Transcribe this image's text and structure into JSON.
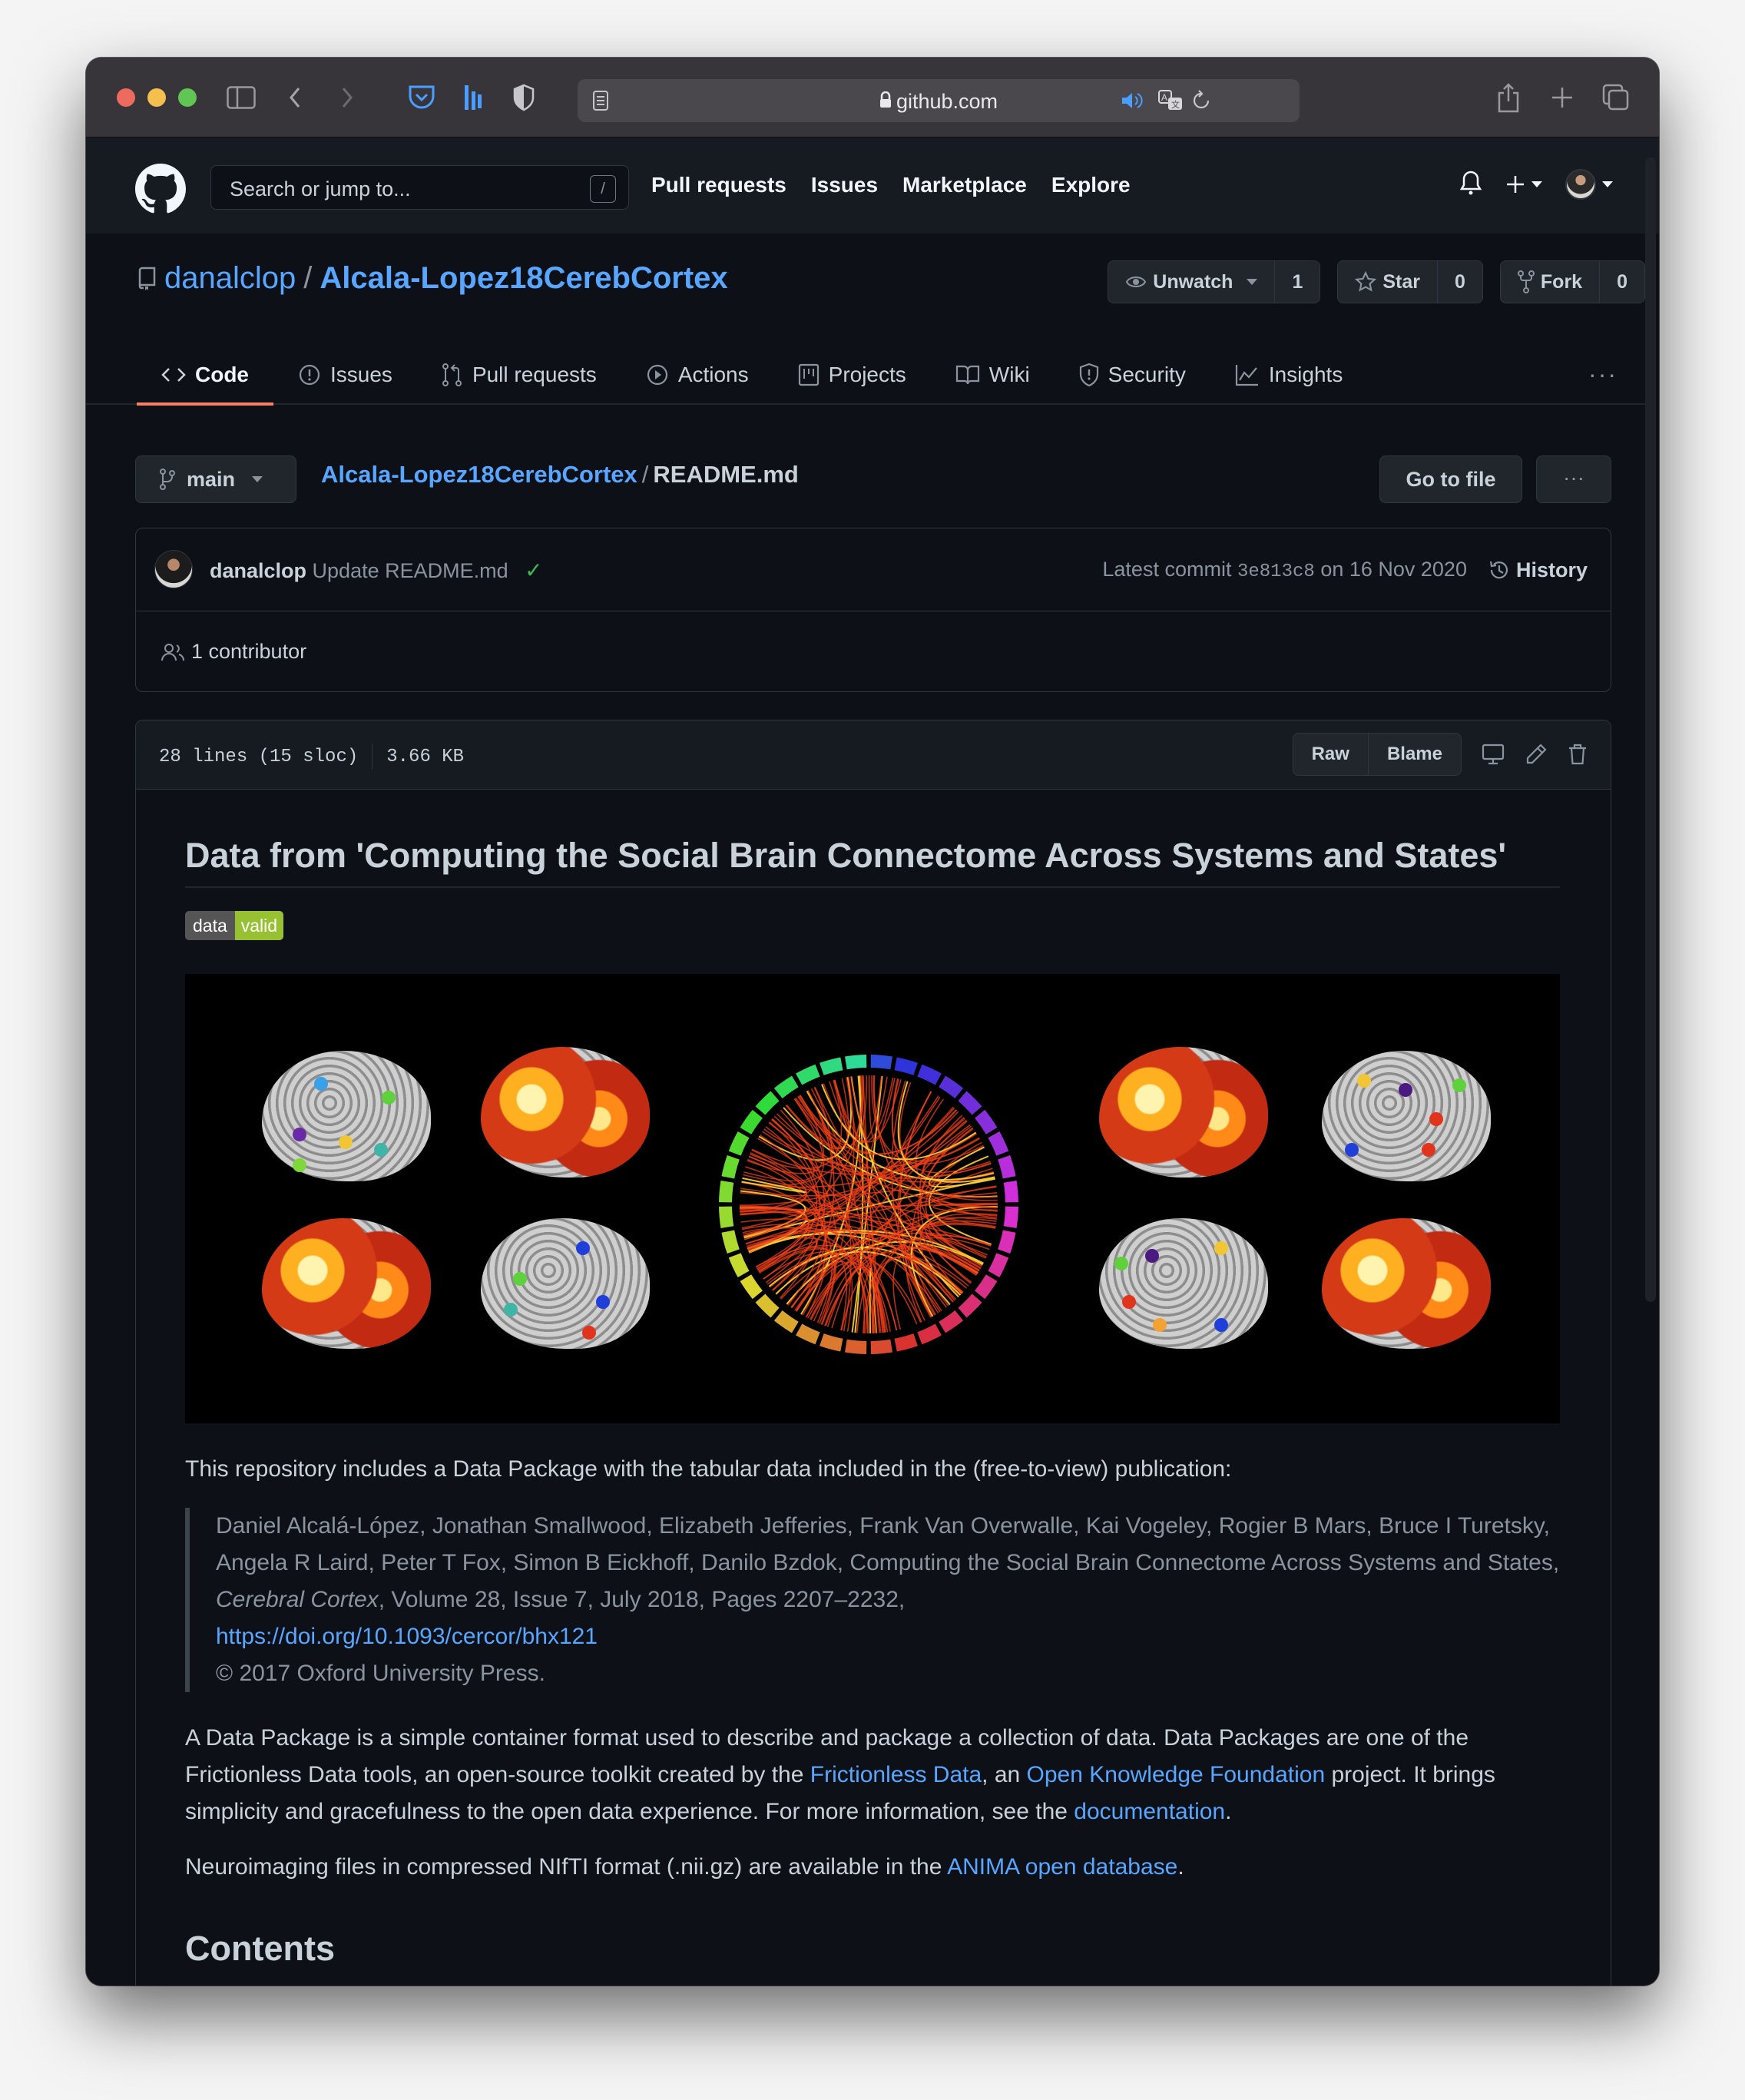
{
  "browser": {
    "url": "github.com",
    "icons": [
      "sidebar-icon",
      "back-icon",
      "forward-icon",
      "pocket-icon",
      "extension-icon",
      "privacy-shield-icon",
      "reader-icon",
      "audio-icon",
      "translate-icon",
      "reload-icon",
      "share-icon",
      "new-tab-icon",
      "tab-overview-icon"
    ]
  },
  "header": {
    "search_placeholder": "Search or jump to...",
    "search_shortcut": "/",
    "nav": [
      "Pull requests",
      "Issues",
      "Marketplace",
      "Explore"
    ]
  },
  "repo": {
    "owner": "danalclop",
    "separator": "/",
    "name": "Alcala-Lopez18CerebCortex",
    "watch_label": "Unwatch",
    "watch_count": "1",
    "star_label": "Star",
    "star_count": "0",
    "fork_label": "Fork",
    "fork_count": "0",
    "tabs": [
      {
        "label": "Code",
        "icon": "code-icon",
        "active": true
      },
      {
        "label": "Issues",
        "icon": "issue-icon",
        "active": false
      },
      {
        "label": "Pull requests",
        "icon": "pull-request-icon",
        "active": false
      },
      {
        "label": "Actions",
        "icon": "play-icon",
        "active": false
      },
      {
        "label": "Projects",
        "icon": "project-icon",
        "active": false
      },
      {
        "label": "Wiki",
        "icon": "book-icon",
        "active": false
      },
      {
        "label": "Security",
        "icon": "shield-icon",
        "active": false
      },
      {
        "label": "Insights",
        "icon": "graph-icon",
        "active": false
      }
    ],
    "more": "···"
  },
  "file_nav": {
    "branch": "main",
    "crumb_repo": "Alcala-Lopez18CerebCortex",
    "crumb_sep": "/",
    "crumb_file": "README.md",
    "go_to_file": "Go to file",
    "more": "···"
  },
  "commit": {
    "author": "danalclop",
    "message": "Update README.md",
    "status": "✓",
    "latest_prefix": "Latest commit",
    "sha": "3e813c8",
    "date_text": "on 16 Nov 2020",
    "history_label": "History",
    "contributors": "1 contributor"
  },
  "file": {
    "lines": "28 lines (15 sloc)",
    "size": "3.66 KB",
    "raw_label": "Raw",
    "blame_label": "Blame"
  },
  "readme": {
    "title": "Data from 'Computing the Social Brain Connectome Across Systems and States'",
    "badge_left": "data",
    "badge_right": "valid",
    "badge_colors": {
      "left": "#555555",
      "right": "#97c133"
    },
    "intro": "This repository includes a Data Package with the tabular data included in the (free-to-view) publication:",
    "citation": {
      "authors": "Daniel Alcalá-López, Jonathan Smallwood, Elizabeth Jefferies, Frank Van Overwalle, Kai Vogeley, Rogier B Mars, Bruce I Turetsky, Angela R Laird, Peter T Fox, Simon B Eickhoff, Danilo Bzdok, Computing the Social Brain Connectome Across Systems and States, ",
      "journal": "Cerebral Cortex",
      "details": ", Volume 28, Issue 7, July 2018, Pages 2207–2232,",
      "doi": "https://doi.org/10.1093/cercor/bhx121",
      "copyright": "© 2017 Oxford University Press."
    },
    "para2": {
      "t1": "A Data Package is a simple container format used to describe and package a collection of data. Data Packages are one of the Frictionless Data tools, an open-source toolkit created by the ",
      "link1": "Frictionless Data",
      "t2": ", an ",
      "link2": "Open Knowledge Foundation",
      "t3": " project. It brings simplicity and gracefulness to the open data experience. For more information, see the ",
      "link3": "documentation",
      "t4": "."
    },
    "para3": {
      "t1": "Neuroimaging files in compressed NIfTI format (.nii.gz) are available in the ",
      "link": "ANIMA open database",
      "t2": "."
    },
    "contents_heading": "Contents"
  },
  "colors": {
    "link": "#58a6ff",
    "tab_active": "#f78166",
    "success": "#3fb950"
  }
}
